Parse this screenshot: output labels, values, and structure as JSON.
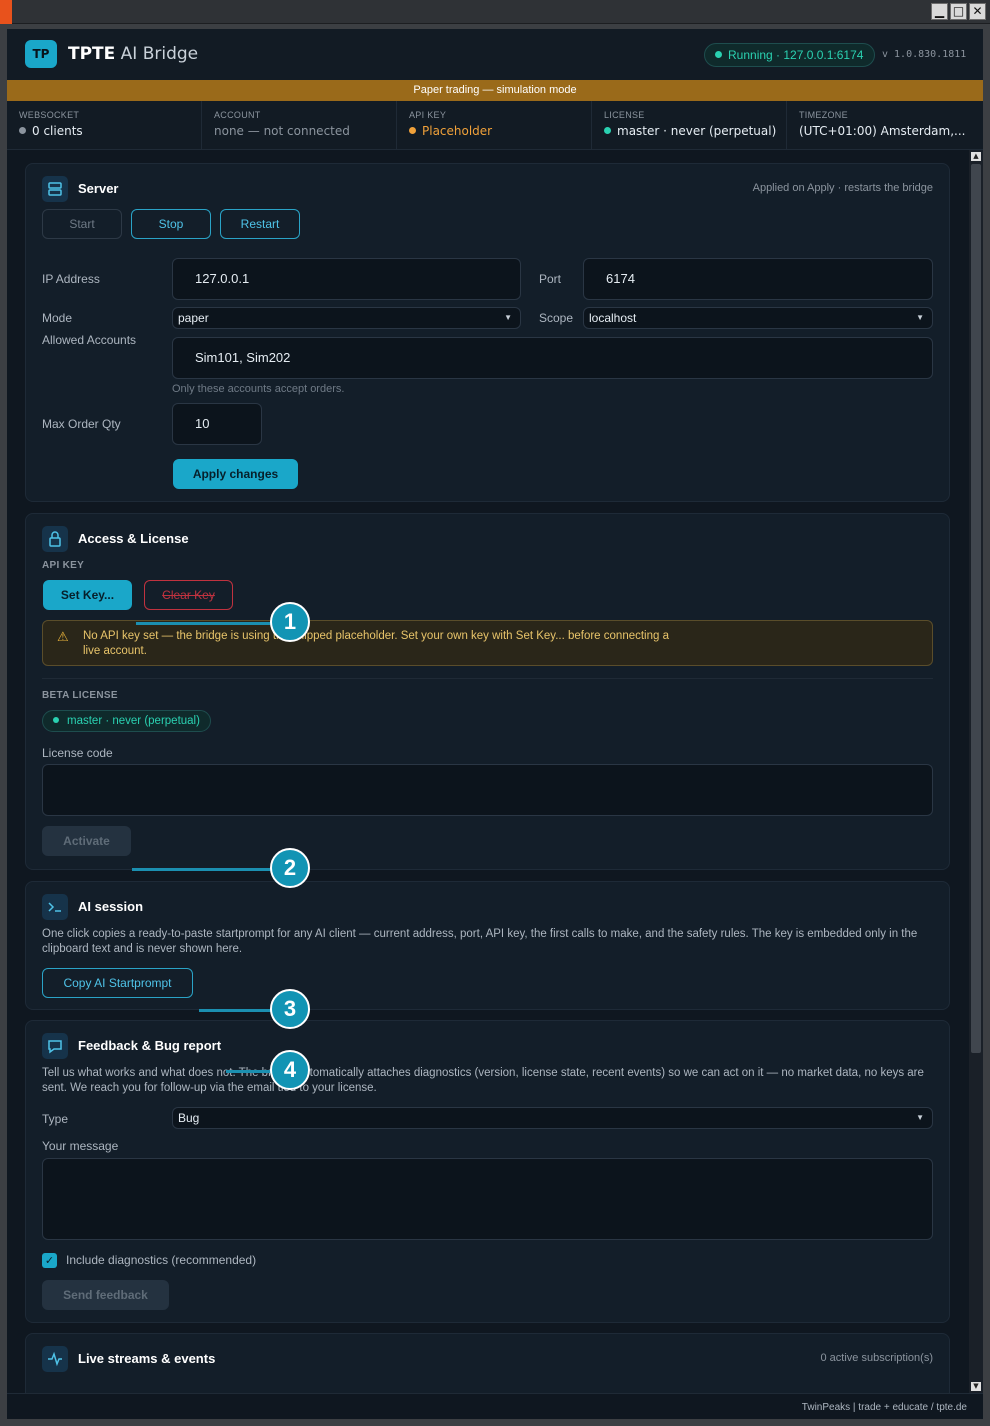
{
  "window": {
    "min_label": "▁",
    "max_label": "□",
    "close_label": "✕"
  },
  "header": {
    "logo": "TP",
    "title_bold": "TPTE",
    "title_rest": " AI Bridge",
    "status": "Running · 127.0.0.1:6174",
    "version": "v 1.0.830.1811"
  },
  "banner": "Paper trading — simulation mode",
  "status_bar": [
    {
      "label": "WEBSOCKET",
      "value": "0 clients",
      "dot_color": "#8b949e"
    },
    {
      "label": "ACCOUNT",
      "value": "none — not connected"
    },
    {
      "label": "API KEY",
      "value": "Placeholder",
      "dot_color": "#f0a13a"
    },
    {
      "label": "LICENSE",
      "value": "master · never (perpetual)",
      "dot_color": "#2ad1b1"
    },
    {
      "label": "TIMEZONE",
      "value": "(UTC+01:00) Amsterdam,..."
    }
  ],
  "server": {
    "title": "Server",
    "note": "Applied on Apply · restarts the bridge",
    "start": "Start",
    "stop": "Stop",
    "restart": "Restart",
    "ip_label": "IP Address",
    "ip_value": "127.0.0.1",
    "port_label": "Port",
    "port_value": "6174",
    "mode_label": "Mode",
    "mode_value": "paper",
    "scope_label": "Scope",
    "scope_value": "localhost",
    "accounts_label": "Allowed Accounts",
    "accounts_value": "Sim101, Sim202",
    "accounts_hint": "Only these accounts accept orders.",
    "maxqty_label": "Max Order Qty",
    "maxqty_value": "10",
    "apply": "Apply changes"
  },
  "access": {
    "title": "Access & License",
    "api_key_heading": "API KEY",
    "set_key": "Set Key...",
    "clear_key": "Clear Key",
    "warning": "No API key set — the bridge is using the shipped placeholder. Set your own key with Set Key... before connecting a live account.",
    "beta_heading": "BETA LICENSE",
    "license_pill": "master · never (perpetual)",
    "license_code_label": "License code",
    "license_code_value": "",
    "activate": "Activate"
  },
  "ai_session": {
    "title": "AI session",
    "description": "One click copies a ready-to-paste startprompt for any AI client — current address, port, API key, the first calls to make, and the safety rules. The key is embedded only in the clipboard text and is never shown here.",
    "copy": "Copy AI Startprompt"
  },
  "feedback": {
    "title": "Feedback & Bug report",
    "description": "Tell us what works and what does not. The bridge automatically attaches diagnostics (version, license state, recent events) so we can act on it — no market data, no keys are sent. We reach you for follow-up via the email tied to your license.",
    "type_label": "Type",
    "type_value": "Bug",
    "message_label": "Your message",
    "message_value": "",
    "diagnostics_label": "Include diagnostics (recommended)",
    "send": "Send feedback"
  },
  "streams": {
    "title": "Live streams & events",
    "note": "0 active subscription(s)"
  },
  "callouts": [
    "1",
    "2",
    "3",
    "4"
  ],
  "footer": "TwinPeaks | trade + educate / tpte.de",
  "colors": {
    "accent": "#1aa7c9",
    "running": "#2ad1b1",
    "warning": "#f0a13a",
    "danger": "#c0323f",
    "banner": "#9a6a1a"
  }
}
